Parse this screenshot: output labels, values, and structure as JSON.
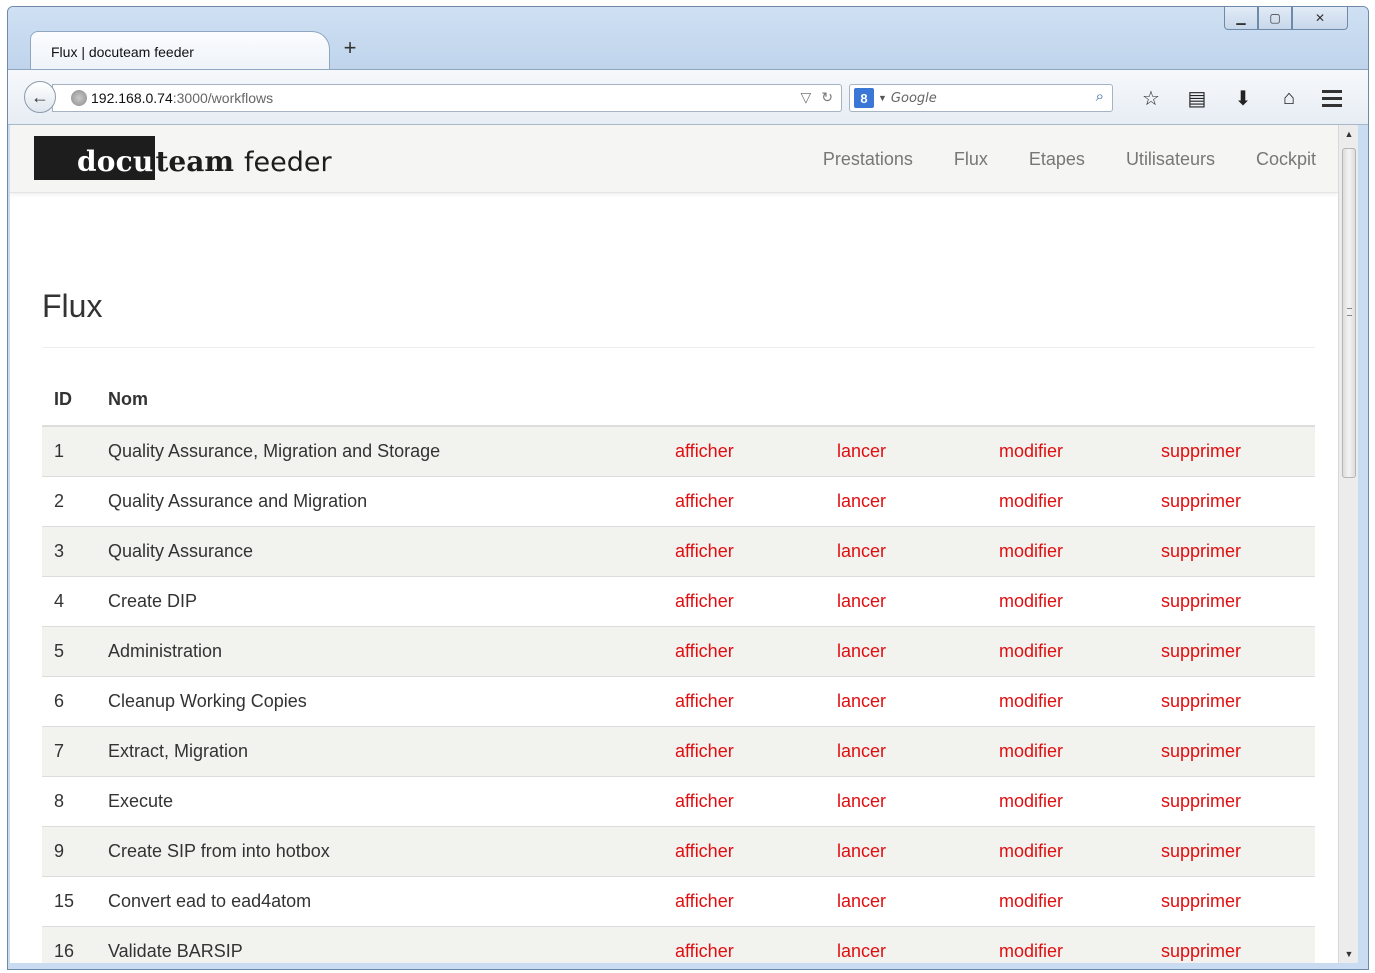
{
  "browser": {
    "tab_title": "Flux | docuteam feeder",
    "new_tab_symbol": "+",
    "url_host": "192.168.0.74",
    "url_rest": ":3000/workflows",
    "search_engine_badge": "8",
    "search_placeholder": "Google"
  },
  "app": {
    "brand_box": "docu",
    "brand_mid": "team",
    "brand_end": "feeder",
    "nav": [
      "Prestations",
      "Flux",
      "Etapes",
      "Utilisateurs",
      "Cockpit"
    ]
  },
  "page": {
    "title": "Flux",
    "columns": {
      "id": "ID",
      "name": "Nom"
    },
    "actions": {
      "show": "afficher",
      "run": "lancer",
      "edit": "modifier",
      "delete": "supprimer"
    },
    "rows": [
      {
        "id": "1",
        "name": "Quality Assurance, Migration and Storage"
      },
      {
        "id": "2",
        "name": "Quality Assurance and Migration"
      },
      {
        "id": "3",
        "name": "Quality Assurance"
      },
      {
        "id": "4",
        "name": "Create DIP"
      },
      {
        "id": "5",
        "name": "Administration"
      },
      {
        "id": "6",
        "name": "Cleanup Working Copies"
      },
      {
        "id": "7",
        "name": "Extract, Migration"
      },
      {
        "id": "8",
        "name": "Execute"
      },
      {
        "id": "9",
        "name": "Create SIP from into hotbox"
      },
      {
        "id": "15",
        "name": "Convert ead to ead4atom"
      },
      {
        "id": "16",
        "name": "Validate BARSIP"
      }
    ]
  },
  "colors": {
    "action_link": "#e00e10",
    "striped_row": "#f2f2ef",
    "navbar_bg": "#f5f5f3"
  },
  "icons": [
    "back-icon",
    "globe-icon",
    "dropdown-icon",
    "reload-icon",
    "search-icon",
    "bookmark-star-icon",
    "reading-list-icon",
    "download-icon",
    "home-icon",
    "menu-icon",
    "minimize-icon",
    "maximize-icon",
    "close-icon"
  ]
}
